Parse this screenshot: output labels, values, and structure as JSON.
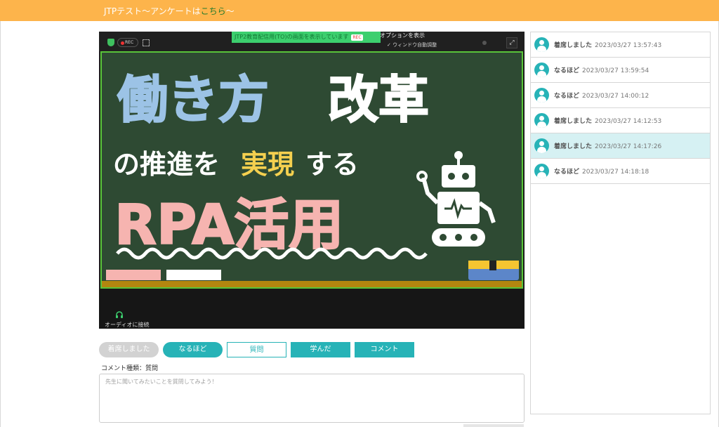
{
  "header": {
    "title_prefix": "JTPテスト～アンケートは",
    "title_link": "こちら",
    "title_suffix": "～"
  },
  "video": {
    "rec_badge": "REC",
    "share_banner": "JTP2教育配信用(TO)の画面を表示しています",
    "share_rec": "REC",
    "options_label": "オプションを表示",
    "auto_adjust": "✓ ウィンドウ自動調整",
    "audio_label": "オーディオに接続",
    "slide": {
      "line1_a": "働き方",
      "line1_b": "改革",
      "line2_a": "の推進を",
      "line2_b": "実現",
      "line2_c": "する",
      "line3": "RPA活用"
    },
    "colors": {
      "blue_text": "#9cc3e6",
      "yellow_text": "#f5d04f",
      "pink_text": "#f6b4b0",
      "board": "#2e4a33"
    }
  },
  "reactions": {
    "attend": "着席しました",
    "naruhodo": "なるほど",
    "question": "質問",
    "learned": "学んだ",
    "comment": "コメント"
  },
  "comment": {
    "type_label": "コメント種類：質問",
    "placeholder": "先生に聞いてみたいことを質問してみよう！"
  },
  "log": [
    {
      "kind": "着席しました",
      "time": "2023/03/27 13:57:43",
      "highlight": false
    },
    {
      "kind": "なるほど",
      "time": "2023/03/27 13:59:54",
      "highlight": false
    },
    {
      "kind": "なるほど",
      "time": "2023/03/27 14:00:12",
      "highlight": false
    },
    {
      "kind": "着席しました",
      "time": "2023/03/27 14:12:53",
      "highlight": false
    },
    {
      "kind": "着席しました",
      "time": "2023/03/27 14:17:26",
      "highlight": true
    },
    {
      "kind": "なるほど",
      "time": "2023/03/27 14:18:18",
      "highlight": false
    }
  ]
}
